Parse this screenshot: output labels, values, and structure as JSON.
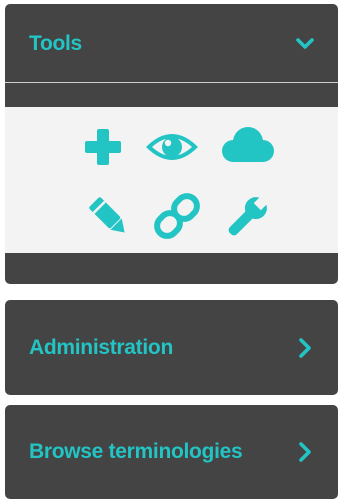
{
  "panels": {
    "tools": {
      "title": "Tools",
      "expanded": true
    },
    "administration": {
      "title": "Administration",
      "expanded": false
    },
    "browse": {
      "title": "Browse terminologies",
      "expanded": false
    }
  },
  "tools": {
    "icons": [
      "plus-icon",
      "eye-icon",
      "cloud-icon",
      "pencil-icon",
      "link-icon",
      "wrench-icon"
    ]
  },
  "colors": {
    "accent": "#22c4c4",
    "panel_bg": "#444444",
    "tools_bg": "#f3f3f3"
  }
}
